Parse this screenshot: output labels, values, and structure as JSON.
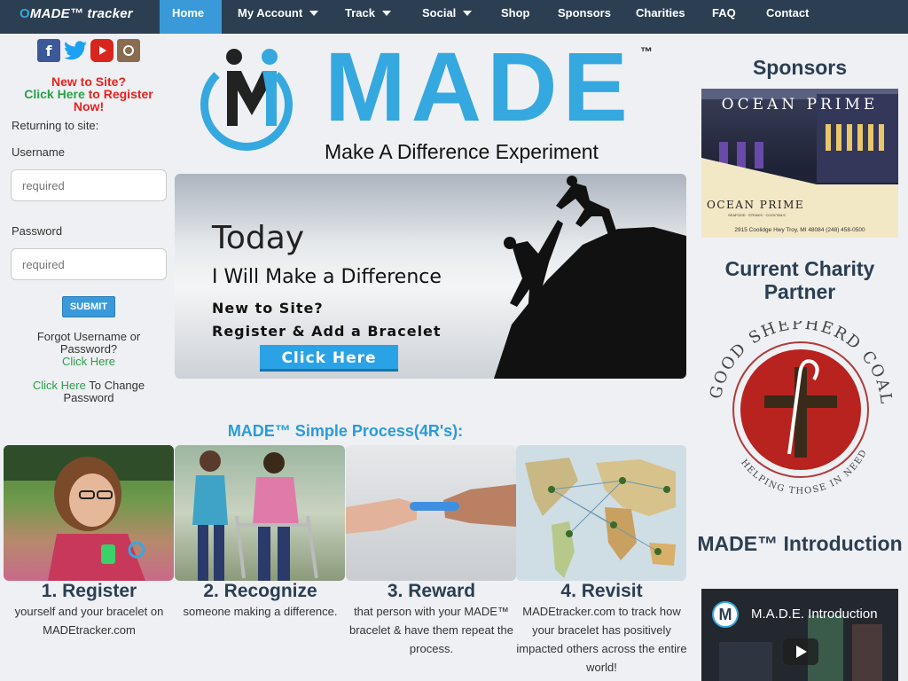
{
  "nav": {
    "brand": "MADE™ tracker",
    "items": [
      {
        "label": "Home",
        "active": true
      },
      {
        "label": "My Account",
        "dropdown": true
      },
      {
        "label": "Track",
        "dropdown": true
      },
      {
        "label": "Social",
        "dropdown": true
      },
      {
        "label": "Shop"
      },
      {
        "label": "Sponsors"
      },
      {
        "label": "Charities"
      },
      {
        "label": "FAQ"
      },
      {
        "label": "Contact"
      }
    ]
  },
  "sidebar": {
    "social_icons": [
      "facebook-icon",
      "twitter-icon",
      "youtube-icon",
      "instagram-icon"
    ],
    "new_to_site": "New to Site?",
    "click_here": "Click Here",
    "register_now": "to Register Now!",
    "returning": "Returning to site:",
    "username_label": "Username",
    "username_placeholder": "required",
    "password_label": "Password",
    "password_placeholder": "required",
    "submit": "SUBMIT",
    "forgot": "Forgot Username or Password?",
    "forgot_link": "Click Here",
    "change_link": "Click Here",
    "change_text": "To Change Password"
  },
  "logo": {
    "word": "MADE",
    "tm": "™",
    "tagline": "Make A Difference Experiment"
  },
  "hero": {
    "line1": "Today",
    "line2": "I Will Make a Difference",
    "line3": "New to Site?",
    "line4": "Register & Add a Bracelet",
    "button": "Click Here"
  },
  "process": {
    "title": "MADE™ Simple Process(4R's):",
    "steps": [
      {
        "title": "1. Register",
        "text": "yourself and your bracelet on MADEtracker.com"
      },
      {
        "title": "2. Recognize",
        "text": "someone making a difference."
      },
      {
        "title": "3. Reward",
        "text": "that person with your MADE™ bracelet & have them repeat the process."
      },
      {
        "title": "4. Revisit",
        "text": "MADEtracker.com to track how your bracelet has positively impacted others across the entire world!"
      }
    ]
  },
  "right": {
    "sponsors_title": "Sponsors",
    "sponsor": {
      "sign": "OCEAN PRIME",
      "name": "OCEAN PRIME",
      "sub": "SEAFOOD · STEAKS · COCKTAILS",
      "address": "2915 Coolidge Hwy Troy, MI 48084 (248) 458-0500"
    },
    "charity_title": "Current Charity Partner",
    "charity": {
      "top_text": "GOOD SHEPHERD COALITION",
      "bottom_text": "HELPING THOSE IN NEED"
    },
    "intro_title": "MADE™ Introduction",
    "video_title": "M.A.D.E. Introduction"
  },
  "colors": {
    "nav_bg": "#2b3e52",
    "accent": "#3a9ad9",
    "brand_blue": "#35a8e0",
    "link_green": "#2aa04a",
    "alert_red": "#e8231f"
  }
}
